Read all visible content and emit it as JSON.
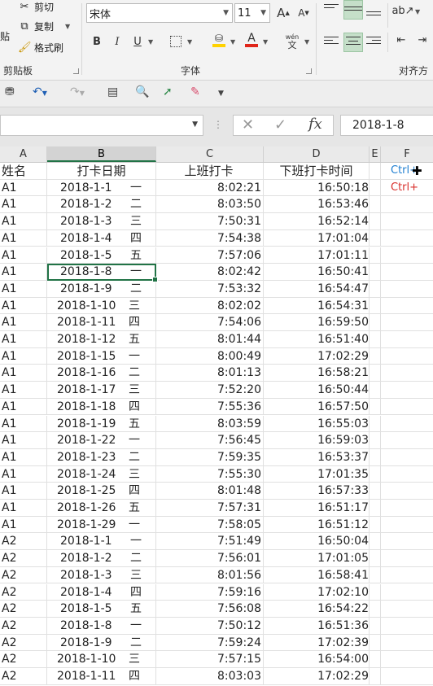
{
  "ribbon": {
    "clipboard": {
      "cut": "剪切",
      "copy": "复制",
      "format_painter": "格式刷",
      "paste_fragment": "贴",
      "group_label": "剪贴板"
    },
    "font": {
      "name": "宋体",
      "size": "11",
      "grow": "A",
      "shrink": "A",
      "bold": "B",
      "italic": "I",
      "underline": "U",
      "font_color_letter": "A",
      "phonetic_top": "wén",
      "phonetic_bottom": "文",
      "group_label": "字体"
    },
    "alignment": {
      "group_label": "对齐方"
    }
  },
  "qat": {
    "undo_arrow": "↶",
    "redo_arrow": "↷"
  },
  "formula_bar": {
    "name_box": "",
    "cancel": "✕",
    "enter": "✓",
    "fx": "fx",
    "value": "2018-1-8"
  },
  "columns": [
    "A",
    "B",
    "C",
    "D",
    "E",
    "F"
  ],
  "header_row": {
    "name": "姓名",
    "date": "打卡日期",
    "in": "上班打卡",
    "out": "下班打卡时间",
    "f_note1": "Ctrl+",
    "f_note2": "Ctrl+"
  },
  "rows": [
    {
      "name": "A1",
      "date": "2018-1-1",
      "wk": "一",
      "in": "8:02:21",
      "out": "16:50:18"
    },
    {
      "name": "A1",
      "date": "2018-1-2",
      "wk": "二",
      "in": "8:03:50",
      "out": "16:53:46"
    },
    {
      "name": "A1",
      "date": "2018-1-3",
      "wk": "三",
      "in": "7:50:31",
      "out": "16:52:14"
    },
    {
      "name": "A1",
      "date": "2018-1-4",
      "wk": "四",
      "in": "7:54:38",
      "out": "17:01:04"
    },
    {
      "name": "A1",
      "date": "2018-1-5",
      "wk": "五",
      "in": "7:57:06",
      "out": "17:01:11"
    },
    {
      "name": "A1",
      "date": "2018-1-8",
      "wk": "一",
      "in": "8:02:42",
      "out": "16:50:41"
    },
    {
      "name": "A1",
      "date": "2018-1-9",
      "wk": "二",
      "in": "7:53:32",
      "out": "16:54:47"
    },
    {
      "name": "A1",
      "date": "2018-1-10",
      "wk": "三",
      "in": "8:02:02",
      "out": "16:54:31"
    },
    {
      "name": "A1",
      "date": "2018-1-11",
      "wk": "四",
      "in": "7:54:06",
      "out": "16:59:50"
    },
    {
      "name": "A1",
      "date": "2018-1-12",
      "wk": "五",
      "in": "8:01:44",
      "out": "16:51:40"
    },
    {
      "name": "A1",
      "date": "2018-1-15",
      "wk": "一",
      "in": "8:00:49",
      "out": "17:02:29"
    },
    {
      "name": "A1",
      "date": "2018-1-16",
      "wk": "二",
      "in": "8:01:13",
      "out": "16:58:21"
    },
    {
      "name": "A1",
      "date": "2018-1-17",
      "wk": "三",
      "in": "7:52:20",
      "out": "16:50:44"
    },
    {
      "name": "A1",
      "date": "2018-1-18",
      "wk": "四",
      "in": "7:55:36",
      "out": "16:57:50"
    },
    {
      "name": "A1",
      "date": "2018-1-19",
      "wk": "五",
      "in": "8:03:59",
      "out": "16:55:03"
    },
    {
      "name": "A1",
      "date": "2018-1-22",
      "wk": "一",
      "in": "7:56:45",
      "out": "16:59:03"
    },
    {
      "name": "A1",
      "date": "2018-1-23",
      "wk": "二",
      "in": "7:59:35",
      "out": "16:53:37"
    },
    {
      "name": "A1",
      "date": "2018-1-24",
      "wk": "三",
      "in": "7:55:30",
      "out": "17:01:35"
    },
    {
      "name": "A1",
      "date": "2018-1-25",
      "wk": "四",
      "in": "8:01:48",
      "out": "16:57:33"
    },
    {
      "name": "A1",
      "date": "2018-1-26",
      "wk": "五",
      "in": "7:57:31",
      "out": "16:51:17"
    },
    {
      "name": "A1",
      "date": "2018-1-29",
      "wk": "一",
      "in": "7:58:05",
      "out": "16:51:12"
    },
    {
      "name": "A2",
      "date": "2018-1-1",
      "wk": "一",
      "in": "7:51:49",
      "out": "16:50:04"
    },
    {
      "name": "A2",
      "date": "2018-1-2",
      "wk": "二",
      "in": "7:56:01",
      "out": "17:01:05"
    },
    {
      "name": "A2",
      "date": "2018-1-3",
      "wk": "三",
      "in": "8:01:56",
      "out": "16:58:41"
    },
    {
      "name": "A2",
      "date": "2018-1-4",
      "wk": "四",
      "in": "7:59:16",
      "out": "17:02:10"
    },
    {
      "name": "A2",
      "date": "2018-1-5",
      "wk": "五",
      "in": "7:56:08",
      "out": "16:54:22"
    },
    {
      "name": "A2",
      "date": "2018-1-8",
      "wk": "一",
      "in": "7:50:12",
      "out": "16:51:36"
    },
    {
      "name": "A2",
      "date": "2018-1-9",
      "wk": "二",
      "in": "7:59:24",
      "out": "17:02:39"
    },
    {
      "name": "A2",
      "date": "2018-1-10",
      "wk": "三",
      "in": "7:57:15",
      "out": "16:54:00"
    },
    {
      "name": "A2",
      "date": "2018-1-11",
      "wk": "四",
      "in": "8:03:03",
      "out": "17:02:29"
    }
  ],
  "colors": {
    "accent_green": "#217346",
    "note_blue": "#1f7fd1",
    "note_red": "#d9302c"
  }
}
